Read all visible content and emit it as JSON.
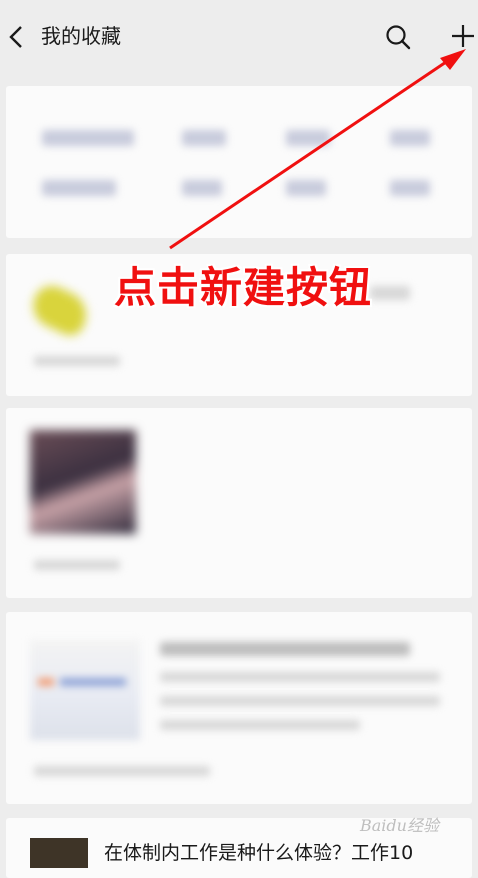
{
  "header": {
    "back_icon": "chevron-left-icon",
    "title": "我的收藏",
    "search_icon": "search-icon",
    "add_icon": "plus-icon"
  },
  "favorites": {
    "last_item_title": "在体制内工作是种什么体验？工作10"
  },
  "annotation": {
    "text": "点击新建按钮",
    "color": "#f01010"
  },
  "watermark": {
    "text": "Baidu经验"
  }
}
